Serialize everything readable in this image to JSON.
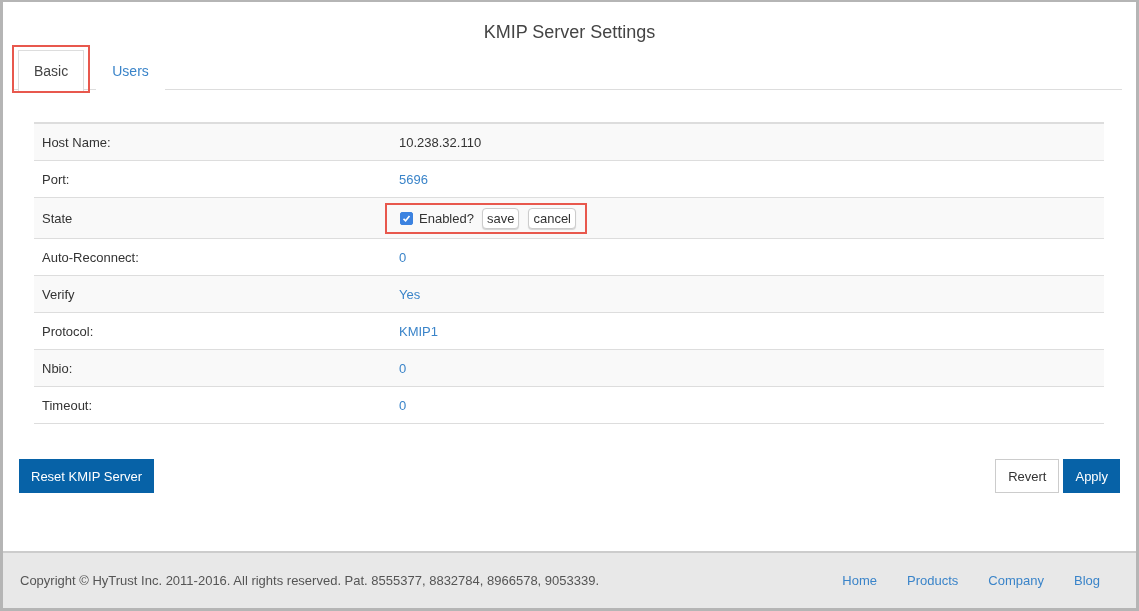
{
  "page": {
    "title": "KMIP Server Settings"
  },
  "tabs": [
    {
      "label": "Basic",
      "selected": true,
      "highlighted": true
    },
    {
      "label": "Users",
      "selected": false,
      "highlighted": false
    }
  ],
  "settings": [
    {
      "label": "Host Name:",
      "kind": "text",
      "value": "10.238.32.110"
    },
    {
      "label": "Port:",
      "kind": "link",
      "value": "5696"
    },
    {
      "label": "State",
      "kind": "editor",
      "checkbox_label": "Enabled?",
      "checked": true,
      "buttons": [
        "save",
        "cancel"
      ],
      "highlighted": true
    },
    {
      "label": "Auto-Reconnect:",
      "kind": "link",
      "value": "0"
    },
    {
      "label": "Verify",
      "kind": "link",
      "value": "Yes"
    },
    {
      "label": "Protocol:",
      "kind": "link",
      "value": "KMIP1"
    },
    {
      "label": "Nbio:",
      "kind": "link",
      "value": "0"
    },
    {
      "label": "Timeout:",
      "kind": "link",
      "value": "0"
    }
  ],
  "actions": {
    "reset": "Reset KMIP Server",
    "revert": "Revert",
    "apply": "Apply"
  },
  "footer": {
    "copyright": "Copyright © HyTrust Inc. 2011-2016. All rights reserved. Pat. 8555377, 8832784, 8966578, 9053339.",
    "links": [
      "Home",
      "Products",
      "Company",
      "Blog"
    ]
  }
}
